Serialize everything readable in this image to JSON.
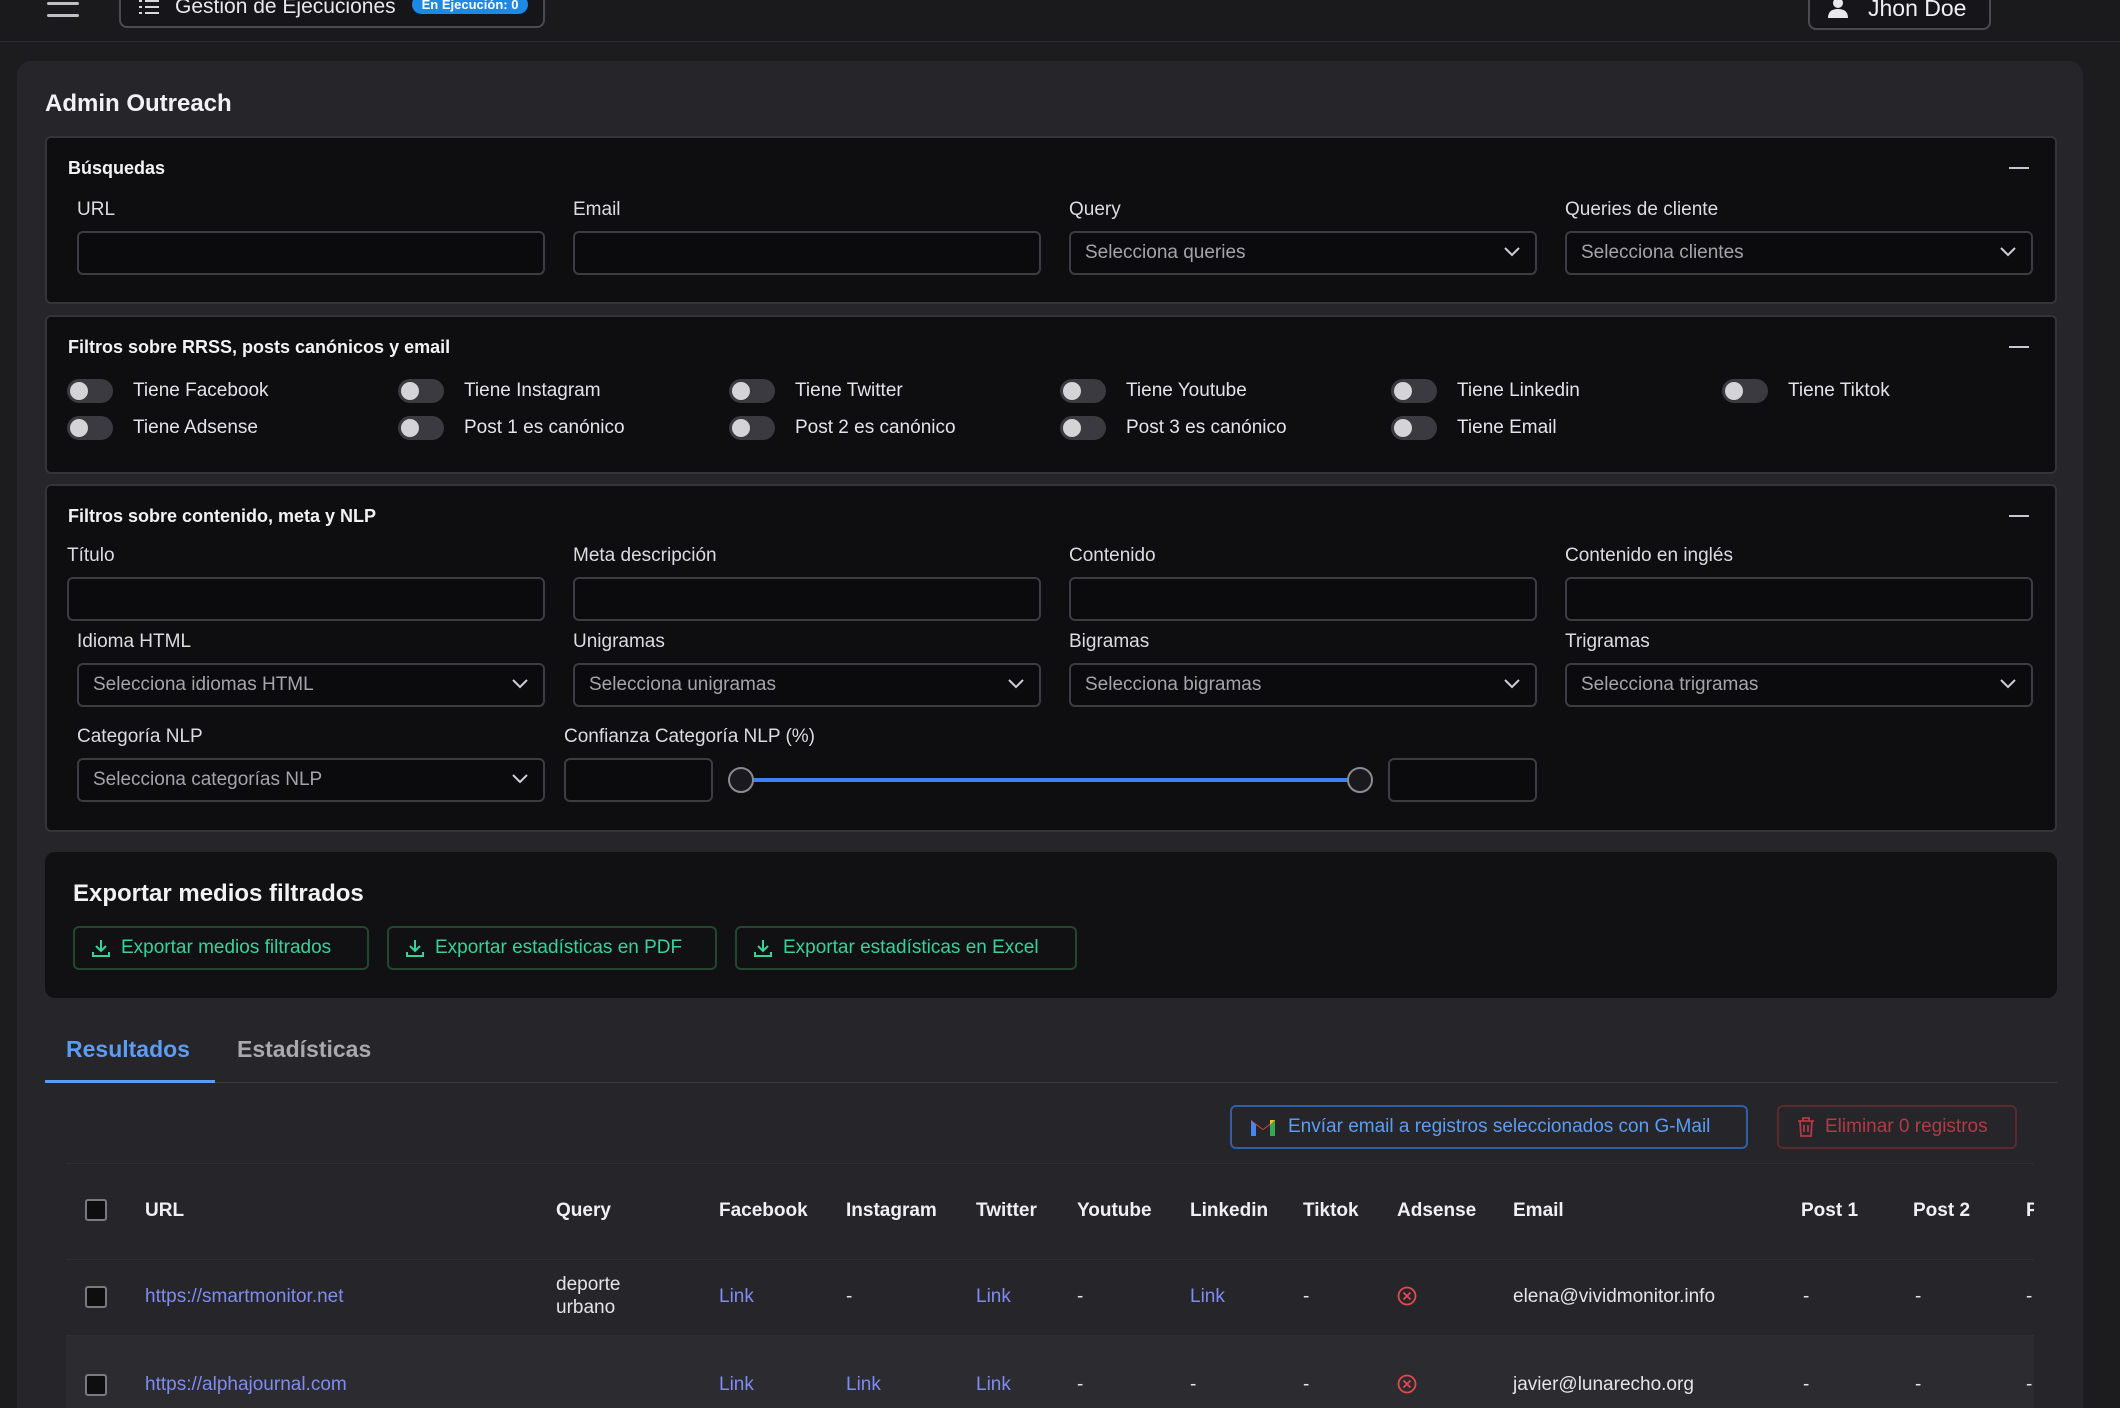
{
  "topbar": {
    "exec_label": "Gestión de Ejecuciones",
    "exec_badge": "En Ejecución: 0",
    "user_name": "Jhon Doe"
  },
  "page_title": "Admin Outreach",
  "busquedas": {
    "title": "Búsquedas",
    "url_label": "URL",
    "email_label": "Email",
    "query_label": "Query",
    "query_placeholder": "Selecciona queries",
    "clientes_label": "Queries de cliente",
    "clientes_placeholder": "Selecciona clientes"
  },
  "rrss": {
    "title": "Filtros sobre RRSS, posts canónicos y email",
    "toggles": [
      "Tiene Facebook",
      "Tiene Instagram",
      "Tiene Twitter",
      "Tiene Youtube",
      "Tiene Linkedin",
      "Tiene Tiktok",
      "Tiene Adsense",
      "Post 1 es canónico",
      "Post 2 es canónico",
      "Post 3 es canónico",
      "Tiene Email"
    ]
  },
  "contenido": {
    "title": "Filtros sobre contenido, meta y NLP",
    "titulo_label": "Título",
    "meta_label": "Meta descripción",
    "contenido_label": "Contenido",
    "contenido_en_label": "Contenido en inglés",
    "idioma_label": "Idioma HTML",
    "idioma_placeholder": "Selecciona idiomas HTML",
    "unigramas_label": "Unigramas",
    "unigramas_placeholder": "Selecciona unigramas",
    "bigramas_label": "Bigramas",
    "bigramas_placeholder": "Selecciona bigramas",
    "trigramas_label": "Trigramas",
    "trigramas_placeholder": "Selecciona trigramas",
    "categoria_label": "Categoría NLP",
    "categoria_placeholder": "Selecciona categorías NLP",
    "confianza_label": "Confianza Categoría NLP (%)"
  },
  "export": {
    "title": "Exportar medios filtrados",
    "btn_medios": "Exportar medios filtrados",
    "btn_pdf": "Exportar estadísticas en PDF",
    "btn_excel": "Exportar estadísticas en Excel"
  },
  "tabs": {
    "resultados": "Resultados",
    "estadisticas": "Estadísticas"
  },
  "actions": {
    "gmail": "Envíar email a registros seleccionados con G-Mail",
    "delete": "Eliminar 0 registros"
  },
  "table": {
    "headers": {
      "url": "URL",
      "query": "Query",
      "facebook": "Facebook",
      "instagram": "Instagram",
      "twitter": "Twitter",
      "youtube": "Youtube",
      "linkedin": "Linkedin",
      "tiktok": "Tiktok",
      "adsense": "Adsense",
      "email": "Email",
      "post1": "Post 1",
      "post2": "Post 2",
      "post3": "P"
    },
    "rows": [
      {
        "url": "https://smartmonitor.net",
        "query_line1": "deporte",
        "query_line2": "urbano",
        "facebook": "Link",
        "instagram": "-",
        "twitter": "Link",
        "youtube": "-",
        "linkedin": "Link",
        "tiktok": "-",
        "email": "elena@vividmonitor.info",
        "post1": "-",
        "post2": "-",
        "post3": "-"
      },
      {
        "url": "https://alphajournal.com",
        "query_line1": "",
        "query_line2": "",
        "facebook": "Link",
        "instagram": "Link",
        "twitter": "Link",
        "youtube": "-",
        "linkedin": "-",
        "tiktok": "-",
        "email": "javier@lunarecho.org",
        "post1": "-",
        "post2": "-",
        "post3": "-"
      }
    ]
  },
  "colors": {
    "accent_blue": "#5b9cf5",
    "export_green": "#34d399",
    "delete_red": "#b23a44",
    "link": "#7f8cf0"
  }
}
